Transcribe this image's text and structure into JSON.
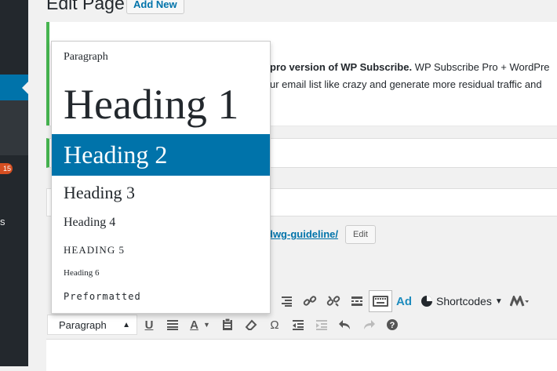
{
  "header": {
    "title": "Edit Page",
    "add_new_label": "Add New"
  },
  "sidebar": {
    "badge_count": "15",
    "menu_letter": "s"
  },
  "notice": {
    "line1_bold": "pro version of WP Subscribe.",
    "line1_rest": " WP Subscribe Pro + WordPre",
    "line2": "ur email list like crazy and generate more residual traffic and"
  },
  "permalink": {
    "link_text": "dwg-guideline/",
    "edit_label": "Edit"
  },
  "format_menu": {
    "items": [
      "Paragraph",
      "Heading 1",
      "Heading 2",
      "Heading 3",
      "Heading 4",
      "HEADING 5",
      "Heading 6",
      "Preformatted"
    ],
    "selected": "Heading 2"
  },
  "toolbar": {
    "format_select_value": "Paragraph",
    "ad_label": "Ad",
    "shortcodes_label": "Shortcodes"
  },
  "colors": {
    "accent": "#0073aa",
    "notice_border": "#46b450",
    "sidebar": "#23282d",
    "badge": "#d54e21"
  }
}
